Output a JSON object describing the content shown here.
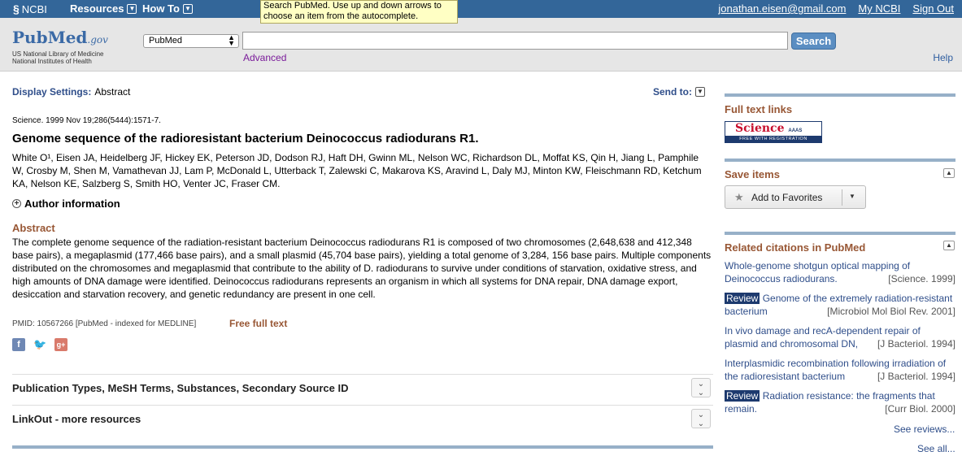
{
  "ncbi_bar": {
    "logo": "NCBI",
    "resources": "Resources",
    "howto": "How To",
    "user_email": "jonathan.eisen@gmail.com",
    "my_ncbi": "My NCBI",
    "sign_out": "Sign Out"
  },
  "tooltip": "Search PubMed. Use up and down arrows to choose an item from the autocomplete.",
  "header": {
    "logo_main": "PubMed",
    "logo_suffix": ".gov",
    "nlm_line1": "US National Library of Medicine",
    "nlm_line2": "National Institutes of Health",
    "db_selected": "PubMed",
    "search_value": "",
    "search_button": "Search",
    "advanced": "Advanced",
    "help": "Help"
  },
  "display": {
    "settings_label": "Display Settings:",
    "settings_value": "Abstract",
    "send_to": "Send to:"
  },
  "article": {
    "journal": "Science.",
    "citation": "1999 Nov 19;286(5444):1571-7.",
    "title": "Genome sequence of the radioresistant bacterium Deinococcus radiodurans R1.",
    "authors_line1": "White O¹, Eisen JA, Heidelberg JF, Hickey EK, Peterson JD, Dodson RJ, Haft DH, Gwinn ML, Nelson WC, Richardson DL, Moffat KS, Qin H, Jiang L, Pamphile",
    "authors_line2": "W, Crosby M, Shen M, Vamathevan JJ, Lam P, McDonald L, Utterback T, Zalewski C, Makarova KS, Aravind L, Daly MJ, Minton KW, Fleischmann RD, Ketchum",
    "authors_line3": "KA, Nelson KE, Salzberg S, Smith HO, Venter JC, Fraser CM.",
    "author_info": "Author information",
    "abstract_heading": "Abstract",
    "abstract_text": "The complete genome sequence of the radiation-resistant bacterium Deinococcus radiodurans R1 is composed of two chromosomes (2,648,638 and 412,348 base pairs), a megaplasmid (177,466 base pairs), and a small plasmid (45,704 base pairs), yielding a total genome of 3,284, 156 base pairs. Multiple components distributed on the chromosomes and megaplasmid that contribute to the ability of D. radiodurans to survive under conditions of starvation, oxidative stress, and high amounts of DNA damage were identified. Deinococcus radiodurans represents an organism in which all systems for DNA repair, DNA damage export, desiccation and starvation recovery, and genetic redundancy are present in one cell.",
    "pmid": "PMID: 10567266 [PubMed - indexed for MEDLINE]",
    "free_full_text": "Free full text"
  },
  "sections": {
    "pub_types": "Publication Types, MeSH Terms, Substances, Secondary Source ID",
    "linkout": "LinkOut - more resources"
  },
  "sidebar": {
    "full_text_heading": "Full text links",
    "science_badge_main": "Science",
    "science_badge_aaas": "AAAS",
    "science_badge_sub": "FREE WITH REGISTRATION",
    "save_heading": "Save items",
    "add_favorites": "Add to Favorites",
    "related_heading": "Related citations in PubMed",
    "review_tag": "Review",
    "related": [
      {
        "title": "Whole-genome shotgun optical mapping of Deinococcus radiodurans.",
        "source": "[Science. 1999]"
      },
      {
        "title": "Genome of the extremely radiation-resistant bacterium",
        "source": "[Microbiol Mol Biol Rev. 2001]"
      },
      {
        "title": "In vivo damage and recA-dependent repair of plasmid and chromosomal DN,",
        "source": "[J Bacteriol. 1994]"
      },
      {
        "title": "Interplasmidic recombination following irradiation of the radioresistant bacterium",
        "source": "[J Bacteriol. 1994]"
      },
      {
        "title": "Radiation resistance: the fragments that remain.",
        "source": "[Curr Biol. 2000]"
      }
    ],
    "see_reviews": "See reviews...",
    "see_all": "See all..."
  }
}
